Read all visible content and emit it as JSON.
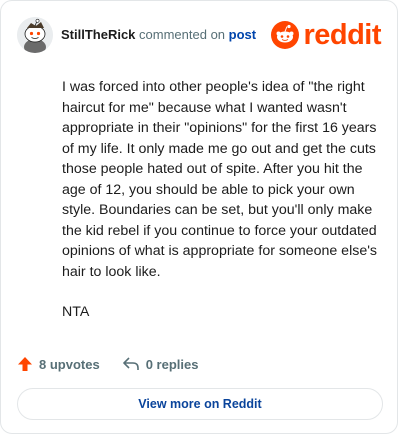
{
  "header": {
    "username": "StillTheRick",
    "commented_on": "commented on",
    "post_link": "post",
    "brand": "reddit"
  },
  "comment": {
    "paragraphs": [
      "I was forced into other people's idea of \"the right haircut for me\" because what I wanted wasn't appropriate in their \"opinions\" for the first 16 years of my life. It only made me go out and get the cuts those people hated out of spite. After you hit the age of 12, you should be able to pick your own style. Boundaries can be set, but you'll only make the kid rebel if you continue to force your outdated opinions of what is appropriate for someone else's hair to look like.",
      "NTA"
    ]
  },
  "actions": {
    "upvotes": "8 upvotes",
    "replies": "0 replies"
  },
  "footer": {
    "view_more": "View more on Reddit"
  },
  "colors": {
    "brand": "#ff4500",
    "link": "#0045ac",
    "muted": "#576f76"
  },
  "icons": {
    "avatar": "reddit-snoo-avatar",
    "logo": "reddit-logo-icon",
    "upvote": "upvote-arrow-icon",
    "reply": "reply-arrow-icon"
  }
}
